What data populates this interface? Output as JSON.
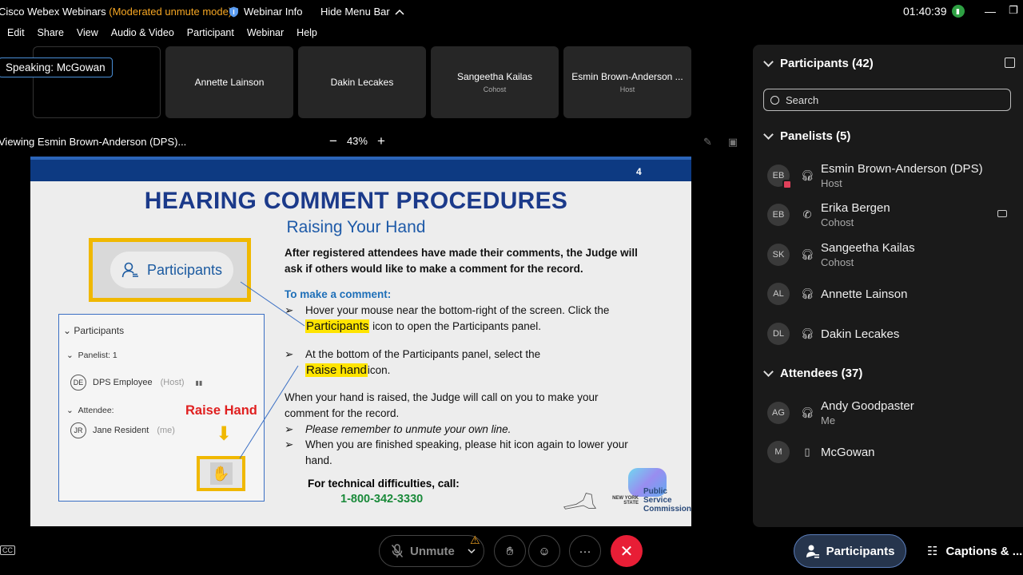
{
  "titlebar": {
    "app": "Cisco Webex Webinars",
    "mode": "(Moderated unmute mode)",
    "webinar_info": "Webinar Info",
    "hide_menu": "Hide Menu Bar",
    "time": "01:40:39"
  },
  "menu": [
    "Edit",
    "Share",
    "View",
    "Audio & Video",
    "Participant",
    "Webinar",
    "Help"
  ],
  "video": {
    "speaking_prefix": "Speaking:",
    "speaking_name": "McGowan",
    "tiles": [
      {
        "name": "Annette Lainson",
        "role": ""
      },
      {
        "name": "Dakin Lecakes",
        "role": ""
      },
      {
        "name": "Sangeetha Kailas",
        "role": "Cohost"
      },
      {
        "name": "Esmin Brown-Anderson ...",
        "role": "Host"
      }
    ]
  },
  "viewing": {
    "label": "Viewing Esmin Brown-Anderson (DPS)...",
    "zoom": "43%"
  },
  "slide": {
    "page": "4",
    "title": "HEARING COMMENT PROCEDURES",
    "subtitle": "Raising Your Hand",
    "participants_pill": "Participants",
    "panel": {
      "header": "Participants",
      "panelist": "Panelist: 1",
      "employee_initials": "DE",
      "employee": "DPS Employee",
      "employee_role": "(Host)",
      "attendee": "Attendee:",
      "resident_initials": "JR",
      "resident": "Jane Resident",
      "resident_role": "(me)"
    },
    "raise_label": "Raise Hand",
    "intro": "After registered attendees have made their comments, the Judge will ask if others would like to make a comment for the record.",
    "make_comment": "To make a comment:",
    "b1_a": "Hover your mouse near the bottom-right of the screen.  Click the",
    "b1_hl": "Participants",
    "b1_b": "icon to open the Participants panel.",
    "b2_a": "At the bottom of the Participants panel, select the",
    "b2_hl": "Raise hand",
    "b2_b": "icon.",
    "raised": "When your hand is raised, the Judge will call on you to make your comment for the record.",
    "b3": "Please remember to unmute your own line.",
    "b4": "When you are finished speaking, please hit icon again to lower your hand.",
    "tech": "For technical difficulties, call:",
    "phone": "1-800-342-3330",
    "psc_state": "NEW YORK STATE",
    "psc_line1": "Public Service",
    "psc_line2": "Commission"
  },
  "panel": {
    "title": "Participants (42)",
    "search_placeholder": "Search",
    "panelists_header": "Panelists (5)",
    "panelists": [
      {
        "initials": "EB",
        "name": "Esmin Brown-Anderson (DPS)",
        "role": "Host"
      },
      {
        "initials": "EB",
        "name": "Erika Bergen",
        "role": "Cohost"
      },
      {
        "initials": "SK",
        "name": "Sangeetha Kailas",
        "role": "Cohost"
      },
      {
        "initials": "AL",
        "name": "Annette Lainson",
        "role": ""
      },
      {
        "initials": "DL",
        "name": "Dakin Lecakes",
        "role": ""
      }
    ],
    "attendees_header": "Attendees (37)",
    "attendees": [
      {
        "initials": "AG",
        "name": "Andy Goodpaster",
        "role": "Me"
      },
      {
        "initials": "M",
        "name": "McGowan",
        "role": ""
      }
    ]
  },
  "toolbar": {
    "unmute": "Unmute",
    "participants": "Participants",
    "captions": "Captions & ...",
    "cc": "CC"
  }
}
